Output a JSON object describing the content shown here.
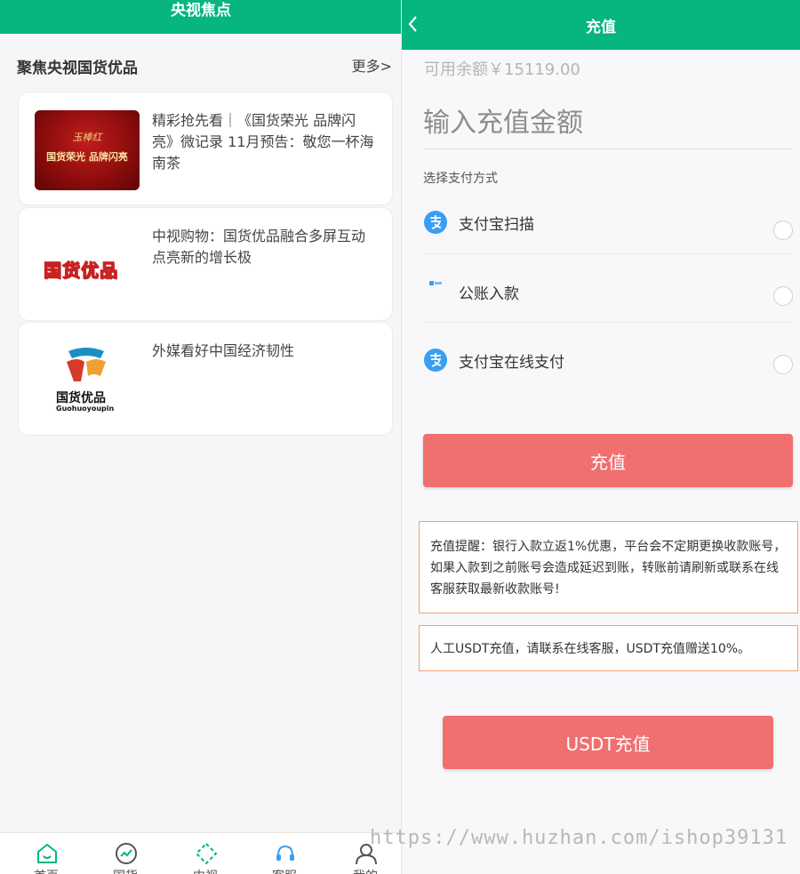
{
  "left": {
    "header_title": "央视焦点",
    "section_title": "聚焦央视国货优品",
    "more_label": "更多>",
    "articles": [
      {
        "title": "精彩抢先看｜《国货荣光 品牌闪亮》微记录 11月预告：敬您一杯海南茶",
        "thumb_line1": "玉棒红",
        "thumb_line2": "国货荣光  品牌闪亮"
      },
      {
        "title": "中视购物：国货优品融合多屏互动 点亮新的增长极",
        "thumb_logo": "国货优品"
      },
      {
        "title": "外媒看好中国经济韧性",
        "thumb_logo": "国货优品",
        "thumb_sub": "Guohuoyoupin"
      }
    ],
    "nav": [
      {
        "label": "首页",
        "icon": "home-icon"
      },
      {
        "label": "国货",
        "icon": "trend-icon"
      },
      {
        "label": "中视",
        "icon": "diamond-icon"
      },
      {
        "label": "客服",
        "icon": "headset-icon"
      },
      {
        "label": "我的",
        "icon": "user-icon"
      }
    ]
  },
  "right": {
    "header_title": "充值",
    "balance": "可用余额￥15119.00",
    "amount_placeholder": "输入充值金额",
    "pay_label": "选择支付方式",
    "methods": [
      {
        "label": "支付宝扫描",
        "icon": "alipay-icon"
      },
      {
        "label": "公账入款",
        "icon": "bank-logo-icon"
      },
      {
        "label": "支付宝在线支付",
        "icon": "alipay-icon"
      }
    ],
    "recharge_button": "充值",
    "notice1": "充值提醒：银行入款立返1%优惠，平台会不定期更换收款账号，如果入款到之前账号会造成延迟到账，转账前请刷新或联系在线客服获取最新收款账号!",
    "notice2": "人工USDT充值，请联系在线客服，USDT充值赠送10%。",
    "usdt_button": "USDT充值"
  },
  "watermark": "https://www.huzhan.com/ishop39131",
  "colors": {
    "brand_green": "#06b57f",
    "button_red": "#f07070",
    "notice_border": "#f1a070",
    "alipay_blue": "#3a9ff2"
  }
}
